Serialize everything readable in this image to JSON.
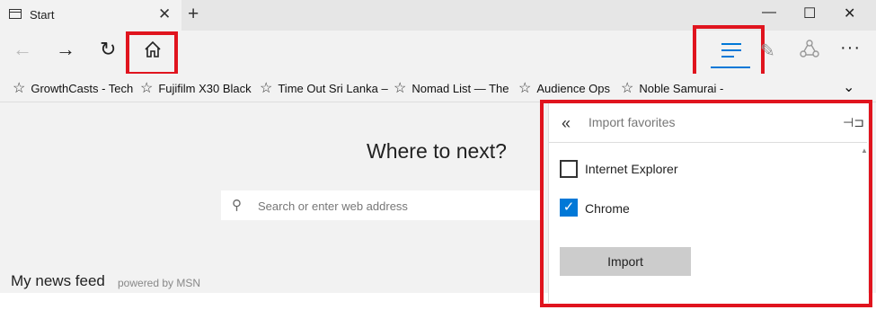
{
  "tab": {
    "title": "Start"
  },
  "window_controls": {
    "minimize": "—",
    "maximize": "☐",
    "close": "✕"
  },
  "favorites": [
    {
      "label": "GrowthCasts - Tech"
    },
    {
      "label": "Fujifilm X30 Black"
    },
    {
      "label": "Time Out Sri Lanka –"
    },
    {
      "label": "Nomad List — The"
    },
    {
      "label": "Audience Ops"
    },
    {
      "label": "Noble Samurai -"
    }
  ],
  "main": {
    "heading": "Where to next?",
    "search_placeholder": "Search or enter web address",
    "news_title": "My news feed",
    "news_powered": "powered by MSN"
  },
  "panel": {
    "title": "Import favorites",
    "options": [
      {
        "label": "Internet Explorer",
        "checked": false
      },
      {
        "label": "Chrome",
        "checked": true
      }
    ],
    "import_label": "Import"
  },
  "colors": {
    "accent": "#0078d7",
    "highlight": "#e0141e"
  },
  "icons": {
    "back": "back-arrow-icon",
    "forward": "forward-arrow-icon",
    "refresh": "refresh-icon",
    "home": "home-icon",
    "hub": "hub-icon",
    "note": "web-note-icon",
    "share": "share-icon",
    "more": "more-icon"
  }
}
